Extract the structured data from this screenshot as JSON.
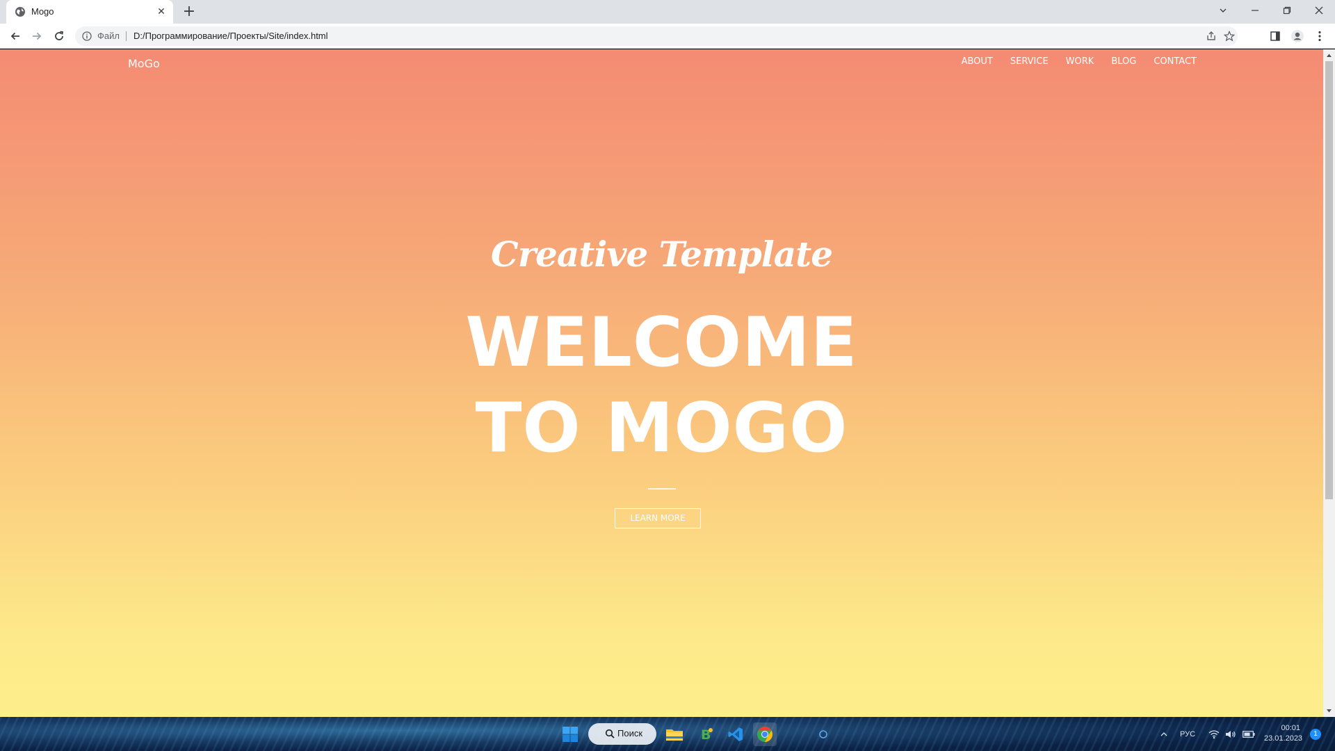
{
  "browser": {
    "tab_title": "Mogo",
    "new_tab_label": "+",
    "close_tab_label": "✕",
    "address_scheme_label": "Файл",
    "address_url": "D:/Программирование/Проекты/Site/index.html"
  },
  "page": {
    "brand": "MoGo",
    "nav": [
      "ABOUT",
      "SERVICE",
      "WORK",
      "BLOG",
      "CONTACT"
    ],
    "subtitle": "Creative Template",
    "headline_line1": "WELCOME",
    "headline_line2": "TO MOGO",
    "button_label": "LEARN MORE",
    "gradient_top": "#f48b73",
    "gradient_bottom": "#feef8b"
  },
  "taskbar": {
    "search_label": "Поиск",
    "language": "РУС",
    "time": "00:01",
    "date": "23.01.2023",
    "notification_count": "1",
    "pinned_icons": [
      "windows-start-icon",
      "search-icon",
      "file-explorer-icon",
      "vk-icon",
      "vscode-icon",
      "chrome-icon"
    ]
  }
}
